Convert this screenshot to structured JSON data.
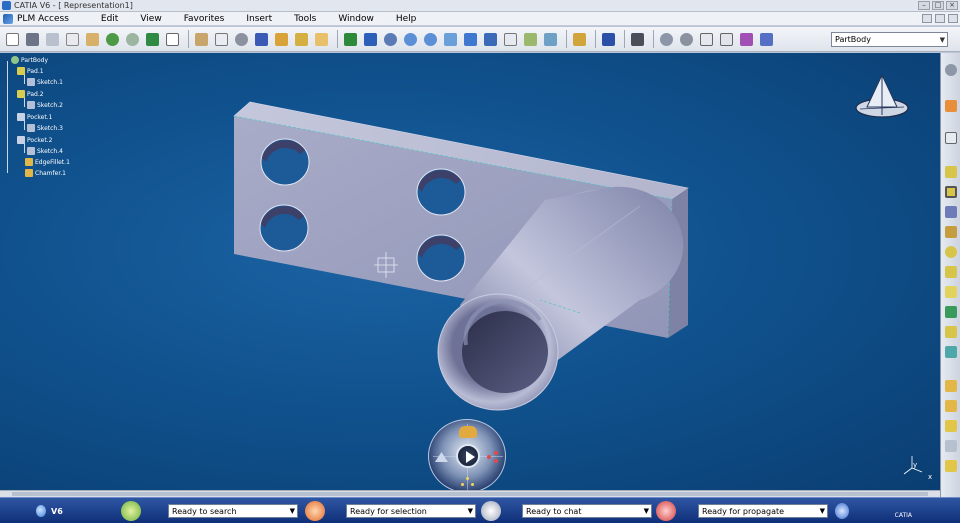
{
  "window": {
    "title": "CATIA V6 - [ Representation1]"
  },
  "menu": {
    "items": [
      "PLM Access",
      "Edit",
      "View",
      "Favorites",
      "Insert",
      "Tools",
      "Window",
      "Help"
    ]
  },
  "toolbar": {
    "part_selector": "PartBody"
  },
  "spec_tree": {
    "root": "PartBody",
    "nodes": [
      {
        "label": "Pad.1"
      },
      {
        "label": "Sketch.1"
      },
      {
        "label": "Pad.2"
      },
      {
        "label": "Sketch.2"
      },
      {
        "label": "Pocket.1"
      },
      {
        "label": "Sketch.3"
      },
      {
        "label": "Pocket.2"
      },
      {
        "label": "Sketch.4"
      },
      {
        "label": "EdgeFillet.1"
      },
      {
        "label": "Chamfer.1"
      }
    ]
  },
  "compass_axis": {
    "x": "x",
    "y": "y"
  },
  "statusbar": {
    "brand": "V6",
    "fields": [
      {
        "value": "Ready to search"
      },
      {
        "value": "Ready for selection"
      },
      {
        "value": "Ready to chat"
      },
      {
        "value": "Ready for propagate"
      }
    ],
    "logo_text": "CATIA"
  },
  "colors": {
    "viewport_background": "#10528e",
    "part_gray": "#9fa3c4",
    "statusbar_blue": "#1e3f8c"
  }
}
